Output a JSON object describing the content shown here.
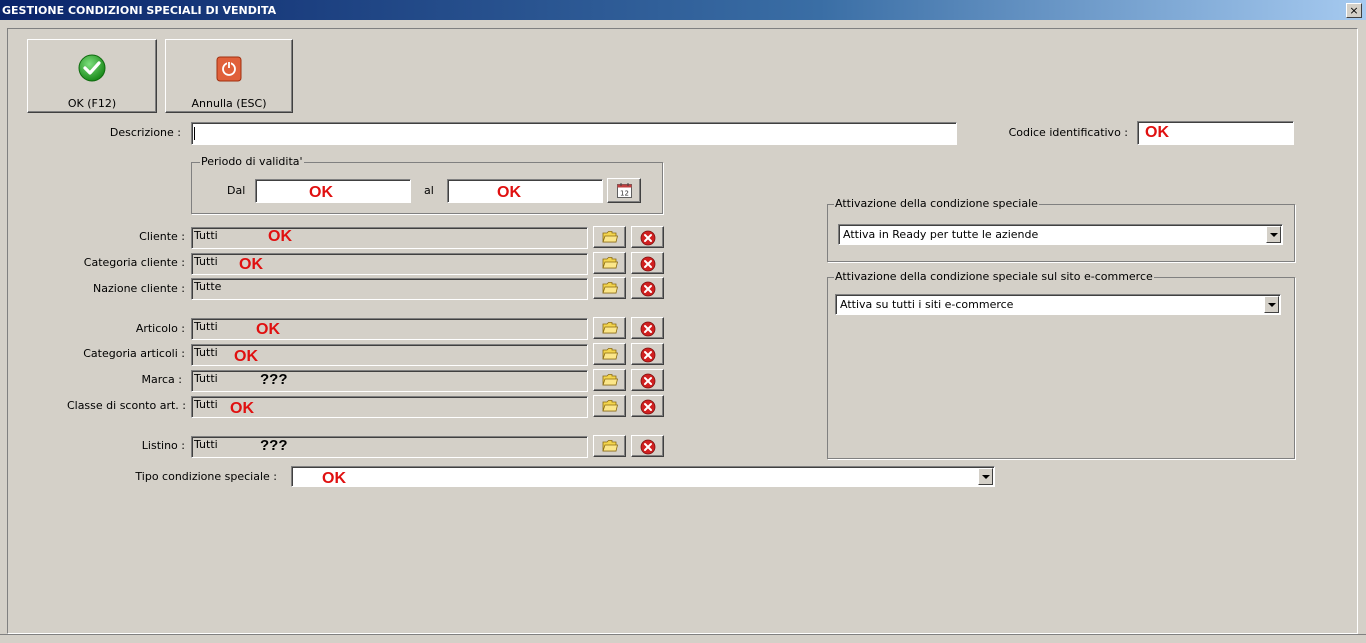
{
  "window": {
    "title": "GESTIONE CONDIZIONI SPECIALI DI VENDITA",
    "close_glyph": "×"
  },
  "toolbar": {
    "ok_label": "OK (F12)",
    "ok_icon": "check-circle-icon",
    "cancel_label": "Annulla (ESC)",
    "cancel_icon": "power-icon"
  },
  "descrizione": {
    "label": "Descrizione :",
    "value": ""
  },
  "codice": {
    "label": "Codice identificativo :",
    "annotation": "OK"
  },
  "periodo": {
    "legend": "Periodo di validita'",
    "dal_label": "Dal",
    "dal_annotation": "OK",
    "al_label": "al",
    "al_annotation": "OK",
    "calendar_icon": "calendar-icon"
  },
  "filters": [
    {
      "label": "Cliente :",
      "value": "Tutti",
      "annotation": "OK"
    },
    {
      "label": "Categoria cliente :",
      "value": "Tutti",
      "annotation": "OK"
    },
    {
      "label": "Nazione cliente :",
      "value": "Tutte",
      "annotation": ""
    },
    {
      "label": "Articolo :",
      "value": "Tutti",
      "annotation": "OK"
    },
    {
      "label": "Categoria articoli :",
      "value": "Tutti",
      "annotation": "OK"
    },
    {
      "label": "Marca :",
      "value": "Tutti",
      "annotation": "???"
    },
    {
      "label": "Classe di sconto art. :",
      "value": "Tutti",
      "annotation": "OK"
    },
    {
      "label": "Listino :",
      "value": "Tutti",
      "annotation": "???"
    }
  ],
  "tipo": {
    "label": "Tipo condizione speciale :",
    "annotation": "OK"
  },
  "attivazione": {
    "legend": "Attivazione della condizione speciale",
    "selected": "Attiva in Ready per tutte le aziende"
  },
  "ecommerce": {
    "legend": "Attivazione della condizione speciale sul sito e-commerce",
    "selected": "Attiva su tutti i siti e-commerce"
  },
  "colors": {
    "annotation": "#e01010",
    "background": "#d4d0c8"
  }
}
